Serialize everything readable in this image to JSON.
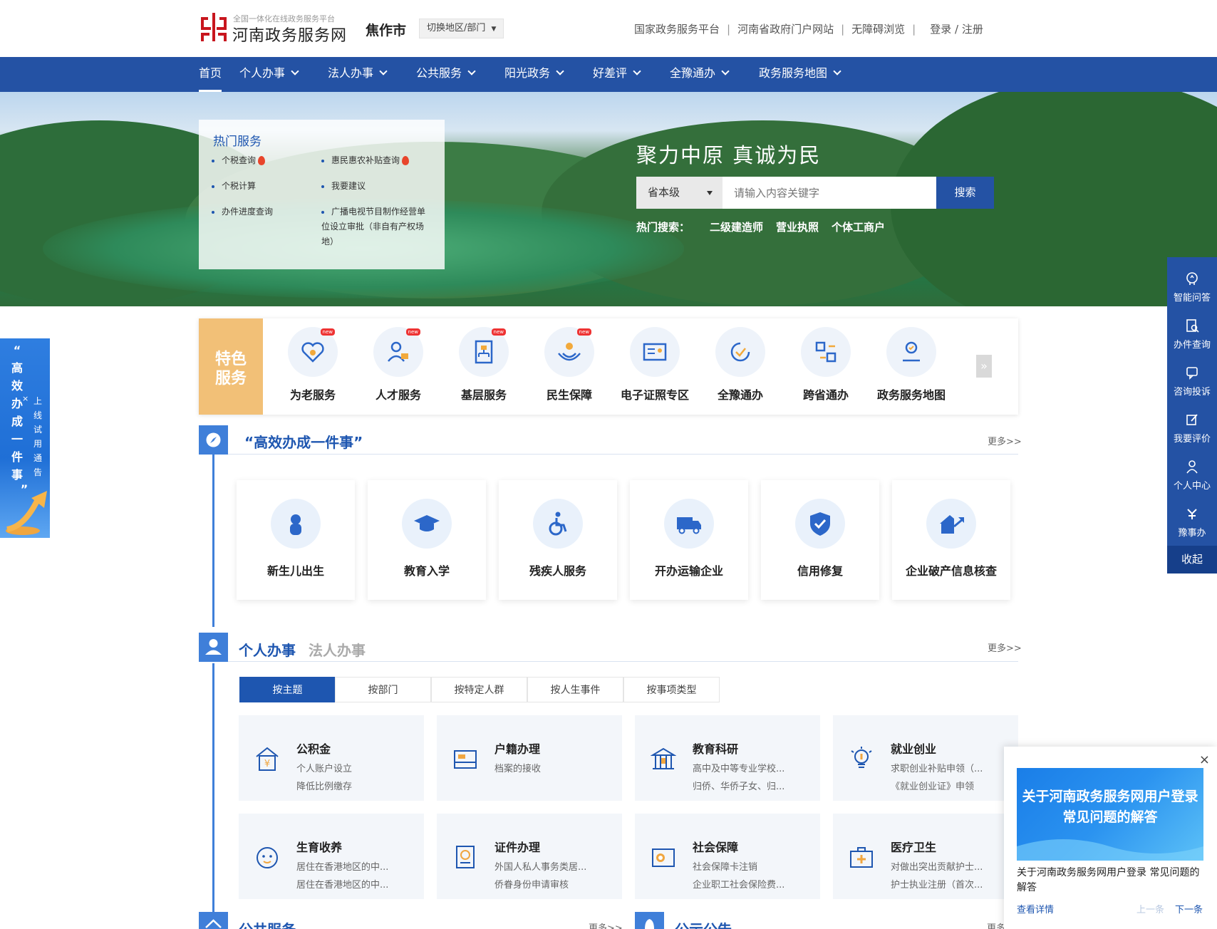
{
  "header": {
    "logo_subtitle": "全国一体化在线政务服务平台",
    "logo_title": "河南政务服务网",
    "city": "焦作市",
    "switch_label": "切换地区/部门",
    "links": [
      "国家政务服务平台",
      "河南省政府门户网站",
      "无障碍浏览",
      "登录 / 注册"
    ],
    "brand_color": "#c8161e"
  },
  "nav": {
    "items": [
      "首页",
      "个人办事",
      "法人办事",
      "公共服务",
      "阳光政务",
      "好差评",
      "全豫通办",
      "政务服务地图"
    ],
    "bg_color": "#2452a4"
  },
  "hot_services": {
    "title": "热门服务",
    "items": [
      "个税查询",
      "惠民惠农补贴查询",
      "个税计算",
      "我要建议",
      "办件进度查询",
      "广播电视节目制作经营单位设立审批（非自有产权场地）"
    ]
  },
  "banner": {
    "slogan": "聚力中原   真诚为民",
    "search": {
      "scope": "省本级",
      "placeholder": "请输入内容关键字",
      "button": "搜索"
    },
    "hot_search_label": "热门搜索：",
    "hot_search_terms": [
      "二级建造师",
      "营业执照",
      "个体工商户"
    ]
  },
  "right_toolbar": {
    "items": [
      "智能问答",
      "办件查询",
      "咨询投诉",
      "我要评价",
      "个人中心",
      "豫事办"
    ],
    "collapse": "收起"
  },
  "left_notice": {
    "main_chars": [
      "“",
      "高",
      "效",
      "办",
      "成",
      "一",
      "件",
      "事",
      "”"
    ],
    "sub_chars": [
      "上",
      "线",
      "试",
      "用",
      "通",
      "告"
    ],
    "close": "×"
  },
  "feature": {
    "label_line1": "特色",
    "label_line2": "服务",
    "new_badge": "new",
    "items": [
      "为老服务",
      "人才服务",
      "基层服务",
      "民生保障",
      "电子证照专区",
      "全豫通办",
      "跨省通办",
      "政务服务地图"
    ],
    "more": "»"
  },
  "efficient": {
    "title": "“高效办成一件事”",
    "more": "更多>>",
    "items": [
      "新生儿出生",
      "教育入学",
      "残疾人服务",
      "开办运输企业",
      "信用修复",
      "企业破产信息核查"
    ]
  },
  "personal": {
    "title": "个人办事",
    "alt_title": "法人办事",
    "more": "更多>>",
    "tabs": [
      "按主题",
      "按部门",
      "按特定人群",
      "按人生事件",
      "按事项类型"
    ],
    "topics": [
      {
        "title": "公积金",
        "line1": "个人账户设立",
        "line2": "降低比例缴存"
      },
      {
        "title": "户籍办理",
        "line1": "档案的接收",
        "line2": ""
      },
      {
        "title": "教育科研",
        "line1": "高中及中等专业学校...",
        "line2": "归侨、华侨子女、归..."
      },
      {
        "title": "就业创业",
        "line1": "求职创业补贴申领（...",
        "line2": "《就业创业证》申领"
      },
      {
        "title": "生育收养",
        "line1": "居住在香港地区的中...",
        "line2": "居住在香港地区的中..."
      },
      {
        "title": "证件办理",
        "line1": "外国人私人事务类居...",
        "line2": "侨眷身份申请审核"
      },
      {
        "title": "社会保障",
        "line1": "社会保障卡注销",
        "line2": "企业职工社会保险费..."
      },
      {
        "title": "医疗卫生",
        "line1": "对做出突出贡献护士...",
        "line2": "护士执业注册（首次..."
      }
    ]
  },
  "bottom": {
    "public_service": "公共服务",
    "public_more": "更多>>",
    "announcement": "公示公告",
    "announcement_more": "更多"
  },
  "popup": {
    "close": "×",
    "image_text": "关于河南政务服务网用户登录常见问题的解答",
    "description": "关于河南政务服务网用户登录 常见问题的解答",
    "detail": "查看详情",
    "prev": "上一条",
    "next": "下一条"
  }
}
